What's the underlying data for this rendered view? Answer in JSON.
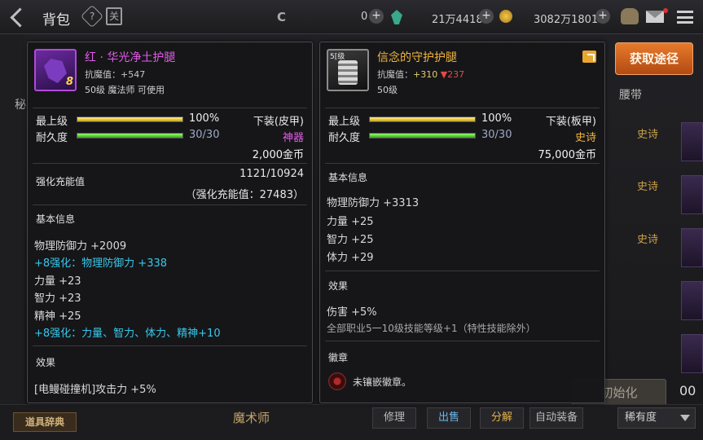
{
  "topbar": {
    "title": "背包",
    "help": "?",
    "book": "关",
    "c_icon": "C",
    "points": "0",
    "bound_gold": "21万4418",
    "gold": "3082万1801"
  },
  "background": {
    "left_tab": "秘",
    "right_tab": "腰带",
    "epic_tags": [
      "史诗",
      "史诗",
      "史诗"
    ],
    "init_button": "初始化",
    "count_frag": "00",
    "bottom": {
      "dict_button": "道具辞典",
      "job_label": "魔术师",
      "repair": "修理",
      "sell": "出售",
      "decompose": "分解",
      "auto_equip": "自动装备",
      "sort_value": "稀有度"
    }
  },
  "route_button": "获取途径",
  "left_item": {
    "badge": "8",
    "name": "红 · 华光净土护腿",
    "resist": "抗魔值：+547",
    "requirement": "50级 魔法师 可使用",
    "level_label": "最上级",
    "level_pct": "100%",
    "level_fill": 1.0,
    "durability_label": "耐久度",
    "durability": "30/30",
    "durability_fill": 1.0,
    "type": "下装(皮甲)",
    "grade": "神器",
    "price": "2,000金币",
    "charge_label": "强化充能值",
    "charge_value": "1121/10924",
    "charge_total": "（强化充能值：27483）",
    "basic_title": "基本信息",
    "basic_lines": [
      "物理防御力 +2009",
      "+8强化：物理防御力 +338",
      "力量 +23",
      "智力 +23",
      "精神 +25",
      "+8强化：力量、智力、体力、精神+10"
    ],
    "effect_title": "效果",
    "effect_line": "[电鳗碰撞机]攻击力 +5%"
  },
  "right_item": {
    "level_badge": "5[级",
    "name": "信念的守护护腿",
    "resist_prefix": "抗魔值：",
    "resist_up": "+310",
    "resist_down": "▼237",
    "requirement": "50级",
    "level_label": "最上级",
    "level_pct": "100%",
    "level_fill": 1.0,
    "durability_label": "耐久度",
    "durability": "30/30",
    "durability_fill": 1.0,
    "type": "下装(板甲)",
    "grade": "史诗",
    "price": "75,000金币",
    "basic_title": "基本信息",
    "basic_lines": [
      "物理防御力 +3313",
      "力量 +25",
      "智力 +25",
      "体力 +29"
    ],
    "effect_title": "效果",
    "effect_lines": [
      "伤害 +5%",
      "全部职业5一10级技能等级+1（特性技能除外）"
    ],
    "emblem_title": "徽章",
    "emblem_line": "未镶嵌徽章。"
  },
  "colors": {
    "mythic": "#e25be9",
    "epic": "#f0b53f",
    "enhance_blue": "#38c8ec",
    "resist_down": "#e24a4a",
    "route_button": "#e77a2c"
  }
}
